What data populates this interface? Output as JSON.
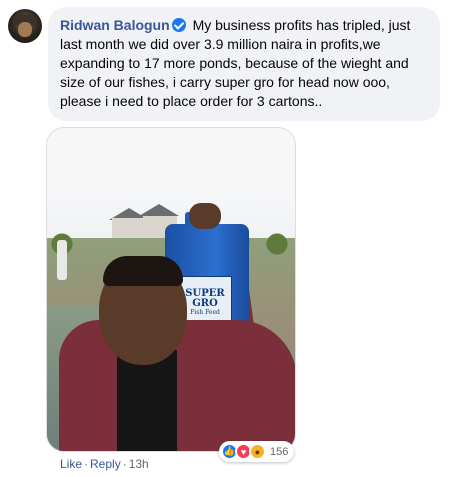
{
  "comment": {
    "author": "Ridwan Balogun",
    "text": "My business profits has tripled, just last month we did over 3.9 million naira in profits,we expanding to 17 more ponds, because of the wieght and size of our fishes, i carry super gro for head now ooo, please i need to place order for 3 cartons..",
    "verified_icon": "verified-badge-icon"
  },
  "photo": {
    "product_label": "SUPER GRO",
    "product_tag": "Fish Feed"
  },
  "reactions": {
    "icons": [
      "like-icon",
      "love-icon",
      "wow-icon"
    ],
    "count": "156"
  },
  "actions": {
    "like": "Like",
    "separator": "·",
    "reply": "Reply",
    "time": "13h"
  },
  "colors": {
    "link": "#385898",
    "bubble_bg": "#f0f2f5",
    "like_blue": "#1877f2",
    "love_red": "#f33e58",
    "wow_yellow": "#f7b125"
  }
}
